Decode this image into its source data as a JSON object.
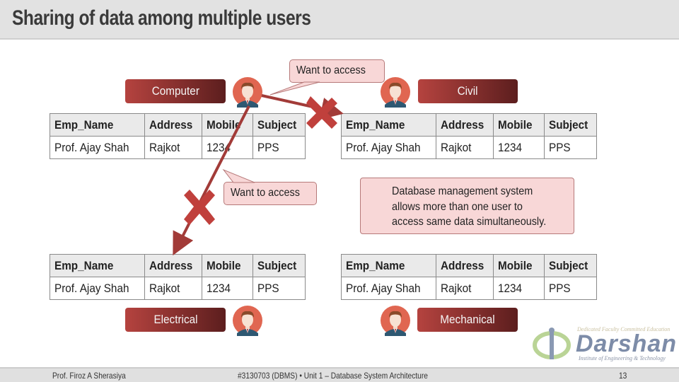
{
  "header": {
    "title": "Sharing of data among multiple users"
  },
  "table_columns": [
    "Emp_Name",
    "Address",
    "Mobile",
    "Subject"
  ],
  "departments": [
    {
      "label": "Computer",
      "row": [
        "Prof. Ajay Shah",
        "Rajkot",
        "1234",
        "PPS"
      ]
    },
    {
      "label": "Civil",
      "row": [
        "Prof. Ajay Shah",
        "Rajkot",
        "1234",
        "PPS"
      ]
    },
    {
      "label": "Electrical",
      "row": [
        "Prof. Ajay Shah",
        "Rajkot",
        "1234",
        "PPS"
      ]
    },
    {
      "label": "Mechanical",
      "row": [
        "Prof. Ajay Shah",
        "Rajkot",
        "1234",
        "PPS"
      ]
    }
  ],
  "callouts": {
    "top": "Want to access",
    "middle": "Want to access"
  },
  "info_box": {
    "lines": [
      "Database management system",
      "allows more than one user to",
      "access same data simultaneously."
    ]
  },
  "footer": {
    "author": "Prof. Firoz A Sherasiya",
    "course": "#3130703 (DBMS)  •  Unit 1 – Database System Architecture",
    "page": "13"
  },
  "logo": {
    "tagline": "Dedicated Faculty Committed Education",
    "name": "Darshan",
    "subtitle": "Institute of Engineering & Technology"
  },
  "colors": {
    "accent_start": "#b5433f",
    "accent_end": "#5c1e1e",
    "callout_bg": "#f8d7d7",
    "cross": "#c0403c",
    "arrow": "#a23b38"
  }
}
